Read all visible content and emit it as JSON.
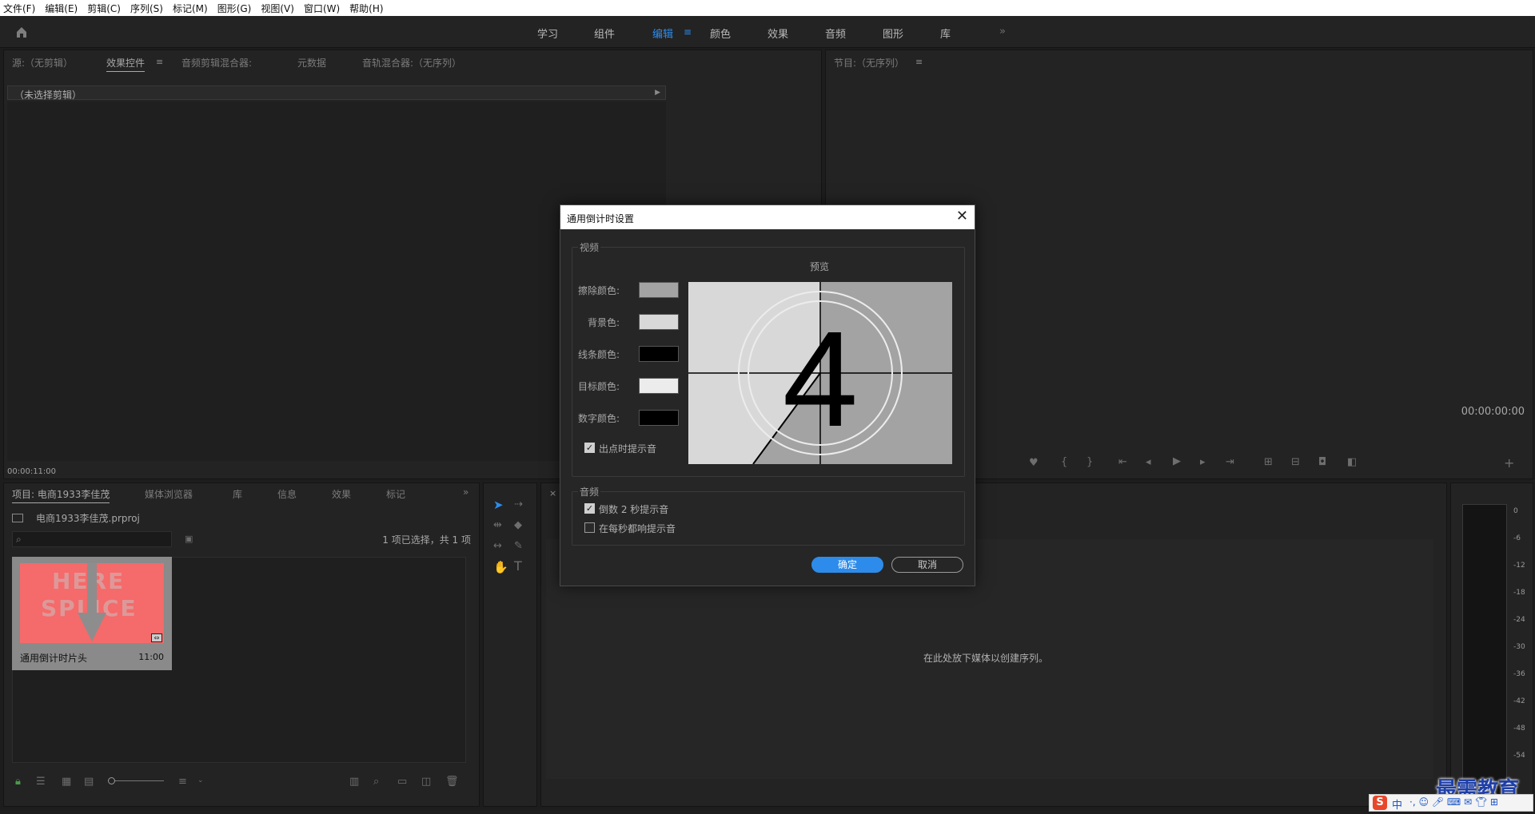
{
  "menu": [
    "文件(F)",
    "编辑(E)",
    "剪辑(C)",
    "序列(S)",
    "标记(M)",
    "图形(G)",
    "视图(V)",
    "窗口(W)",
    "帮助(H)"
  ],
  "workspaces": {
    "tabs": [
      "学习",
      "组件",
      "编辑",
      "颜色",
      "效果",
      "音频",
      "图形",
      "库"
    ],
    "active": "编辑",
    "overflow": "»"
  },
  "source_panel": {
    "tabs": [
      "源:（无剪辑）",
      "效果控件",
      "音频剪辑混合器:",
      "元数据",
      "音轨混合器:（无序列）"
    ],
    "active_tab": "效果控件",
    "no_clip": "（未选择剪辑）",
    "timecode": "00:00:11:00"
  },
  "program_panel": {
    "title": "节目:（无序列）",
    "timecode": "00:00:00:00"
  },
  "project_panel": {
    "tabs": [
      "项目: 电商1933李佳茂",
      "媒体浏览器",
      "库",
      "信息",
      "效果",
      "标记"
    ],
    "project_file": "电商1933李佳茂.prproj",
    "selection_status": "1 项已选择，共 1 项",
    "item": {
      "name": "通用倒计时片头",
      "duration": "11:00",
      "thumb_text_top": "HERE",
      "thumb_text_bottom": "SPLICE",
      "thumb_color": "#f56a6a"
    }
  },
  "timeline_panel": {
    "drop_hint": "在此处放下媒体以创建序列。"
  },
  "audio_meter": {
    "scale": [
      "0",
      "-6",
      "-12",
      "-18",
      "-24",
      "-30",
      "-36",
      "-42",
      "-48",
      "-54"
    ]
  },
  "dialog": {
    "title": "通用倒计时设置",
    "video_group": "视频",
    "preview_label": "预览",
    "colors": [
      {
        "label": "擦除颜色:",
        "value": "#a3a3a3"
      },
      {
        "label": "背景色:",
        "value": "#d8d8d8"
      },
      {
        "label": "线条颜色:",
        "value": "#000000"
      },
      {
        "label": "目标颜色:",
        "value": "#ececec"
      },
      {
        "label": "数字颜色:",
        "value": "#000000"
      }
    ],
    "cue_out_label": "出点时提示音",
    "cue_out_checked": true,
    "preview_digit": "4",
    "audio_group": "音频",
    "beep_2s_label": "倒数 2 秒提示音",
    "beep_2s_checked": true,
    "beep_each_label": "在每秒都响提示音",
    "beep_each_checked": false,
    "ok": "确定",
    "cancel": "取消"
  },
  "watermark": "最需教育",
  "ime": "中"
}
